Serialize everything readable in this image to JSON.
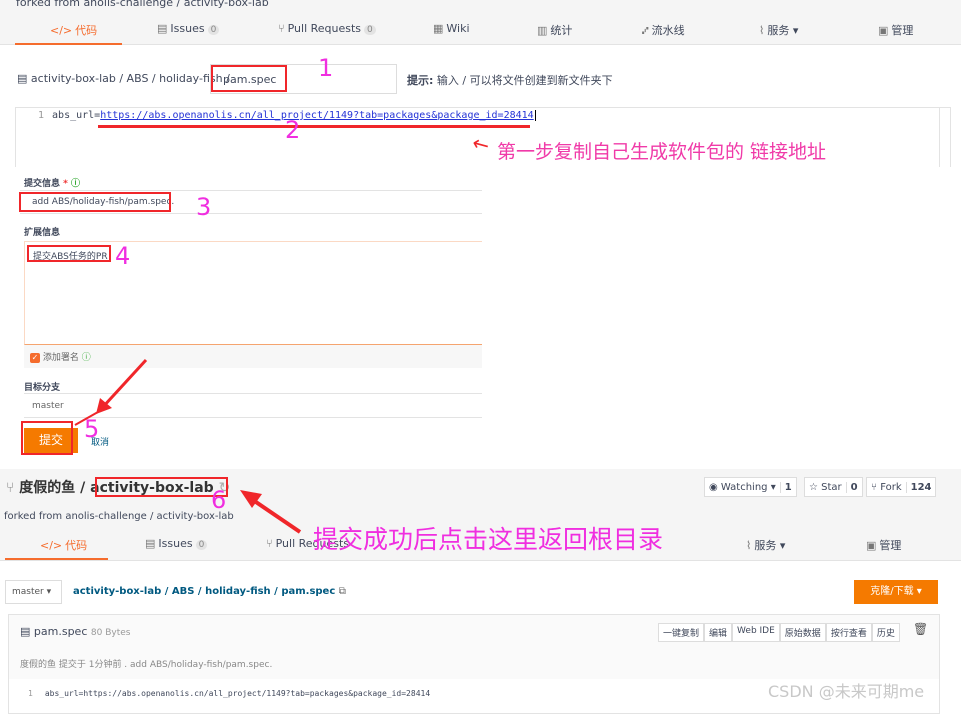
{
  "top": {
    "forked_text": "forked from anolis-challenge / activity-box-lab",
    "tabs": [
      {
        "label": "代码",
        "icon": "code-icon"
      },
      {
        "label": "Issues",
        "count": "0",
        "icon": "issues-icon"
      },
      {
        "label": "Pull Requests",
        "count": "0",
        "icon": "pull-request-icon"
      },
      {
        "label": "Wiki",
        "icon": "wiki-icon"
      },
      {
        "label": "统计",
        "icon": "stats-icon"
      },
      {
        "label": "流水线",
        "icon": "pipeline-icon"
      },
      {
        "label": "服务",
        "icon": "service-icon"
      },
      {
        "label": "管理",
        "icon": "manage-icon"
      }
    ]
  },
  "editor": {
    "path": "activity-box-lab / ABS / holiday-fish /",
    "filename": "pam.spec",
    "hint_label": "提示:",
    "hint": "输入 / 可以将文件创建到新文件夹下",
    "line_no": "1",
    "code_prefix": "abs_url=",
    "code_url": "https://abs.openanolis.cn/all_project/1149?tab=packages&package_id=28414"
  },
  "form": {
    "commit_label": "提交信息",
    "required_mark": "*",
    "commit_value": "add ABS/holiday-fish/pam.spec.",
    "ext_label": "扩展信息",
    "ext_value": "提交ABS任务的PR",
    "signoff_label": "添加署名",
    "signoff_checked": true,
    "branch_label": "目标分支",
    "branch_value": "master",
    "submit": "提交",
    "cancel": "取消"
  },
  "repo": {
    "owner": "度假的鱼",
    "separator": "/",
    "name": "activity-box-lab",
    "forked_text": "forked from anolis-challenge / activity-box-lab",
    "watching": "Watching",
    "watching_count": "1",
    "star": "Star",
    "star_count": "0",
    "fork": "Fork",
    "fork_count": "124",
    "branch": "master",
    "crumbs": [
      "activity-box-lab",
      "ABS",
      "holiday-fish",
      "pam.spec"
    ],
    "clone": "克隆/下载",
    "file_name": "pam.spec",
    "file_size": "80 Bytes",
    "file_actions": [
      "一键复制",
      "编辑",
      "Web IDE",
      "原始数据",
      "按行查看",
      "历史"
    ],
    "commit_info": "度假的鱼 提交于 1分钟前 . add ABS/holiday-fish/pam.spec.",
    "line_no": "1",
    "code": "abs_url=https://abs.openanolis.cn/all_project/1149?tab=packages&package_id=28414"
  },
  "annotations": {
    "n1": "1",
    "n2": "2",
    "n3": "3",
    "n4": "4",
    "n5": "5",
    "n6": "6",
    "step1": "第一步复制自己生成软件包的 链接地址",
    "step6": "提交成功后点击这里返回根目录",
    "color": "#f02ee0"
  },
  "watermark": "CSDN @未来可期me"
}
